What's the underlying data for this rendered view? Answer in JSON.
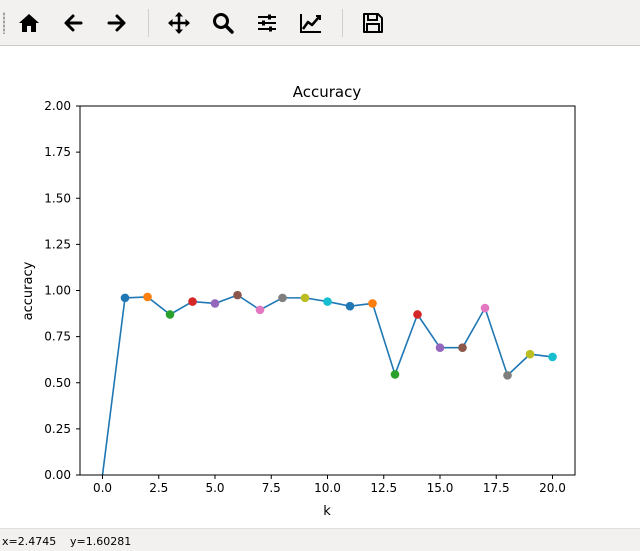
{
  "toolbar": {
    "buttons": [
      {
        "id": "home",
        "icon": "home-icon"
      },
      {
        "id": "back",
        "icon": "arrow-left-icon"
      },
      {
        "id": "forward",
        "icon": "arrow-right-icon"
      },
      {
        "id": "pan",
        "icon": "move-icon"
      },
      {
        "id": "zoom",
        "icon": "zoom-icon"
      },
      {
        "id": "subplots",
        "icon": "sliders-icon"
      },
      {
        "id": "customize",
        "icon": "line-chart-icon"
      },
      {
        "id": "save",
        "icon": "save-icon"
      }
    ]
  },
  "status": {
    "x_readout": "x=2.4745",
    "y_readout": "y=1.60281"
  },
  "chart_data": {
    "type": "line",
    "title": "Accuracy",
    "xlabel": "k",
    "ylabel": "accuracy",
    "xlim": [
      -1,
      21
    ],
    "ylim": [
      0,
      2
    ],
    "xticks": [
      0,
      2.5,
      5,
      7.5,
      10,
      12.5,
      15,
      17.5,
      20
    ],
    "xtick_labels": [
      "0.0",
      "2.5",
      "5.0",
      "7.5",
      "10.0",
      "12.5",
      "15.0",
      "17.5",
      "20.0"
    ],
    "yticks": [
      0,
      0.25,
      0.5,
      0.75,
      1.0,
      1.25,
      1.5,
      1.75,
      2.0
    ],
    "ytick_labels": [
      "0.00",
      "0.25",
      "0.50",
      "0.75",
      "1.00",
      "1.25",
      "1.50",
      "1.75",
      "2.00"
    ],
    "line_color": "#1f77b4",
    "x": [
      0,
      1,
      2,
      3,
      4,
      5,
      6,
      7,
      8,
      9,
      10,
      11,
      12,
      13,
      14,
      15,
      16,
      17,
      18,
      19,
      20
    ],
    "y": [
      0,
      0.96,
      0.965,
      0.87,
      0.94,
      0.93,
      0.975,
      0.895,
      0.96,
      0.96,
      0.94,
      0.915,
      0.93,
      0.545,
      0.87,
      0.69,
      0.69,
      0.905,
      0.54,
      0.655,
      0.64
    ],
    "point_colors": [
      "#1f77b4",
      "#ff7f0e",
      "#2ca02c",
      "#d62728",
      "#9467bd",
      "#8c564b",
      "#e377c2",
      "#7f7f7f",
      "#bcbd22",
      "#17becf",
      "#1f77b4",
      "#ff7f0e",
      "#2ca02c",
      "#d62728",
      "#9467bd",
      "#8c564b",
      "#e377c2",
      "#7f7f7f",
      "#bcbd22",
      "#17becf"
    ],
    "grid": false
  }
}
